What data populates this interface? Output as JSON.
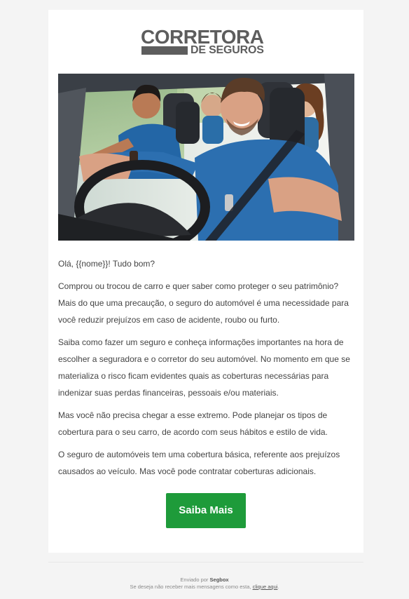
{
  "logo": {
    "line1": "CORRETORA",
    "line2": "DE SEGUROS"
  },
  "hero": {
    "alt": "Friends in a car, driver smiling"
  },
  "body": {
    "greeting": "Olá, {{nome}}! Tudo bom?",
    "p1": "Comprou ou trocou de carro e quer saber como proteger o seu patrimônio? Mais do que uma precaução, o seguro do automóvel é uma necessidade para você reduzir prejuízos em caso de acidente, roubo ou furto.",
    "p2": "Saiba como fazer um seguro e conheça informações importantes na hora de escolher a seguradora e o corretor do seu automóvel. No momento em que se materializa o risco ficam evidentes quais as coberturas necessárias para indenizar suas perdas financeiras, pessoais e/ou materiais.",
    "p3": "Mas você não precisa chegar a esse extremo. Pode planejar os tipos de cobertura para o seu carro, de acordo com seus hábitos e estilo de vida.",
    "p4": "O seguro de automóveis tem uma cobertura básica, referente aos prejuízos causados ao veículo. Mas você pode contratar coberturas adicionais."
  },
  "cta": {
    "label": "Saiba Mais"
  },
  "footer": {
    "sent_by": "Enviado por",
    "brand": "Segbox",
    "unsubscribe_text": "Se deseja não receber mais mensagens como esta,",
    "unsubscribe_link": "clique aqui",
    "period": "."
  },
  "colors": {
    "cta": "#1e9b3a",
    "logo": "#5d5d5d",
    "text": "#444444",
    "background": "#f4f4f4"
  }
}
